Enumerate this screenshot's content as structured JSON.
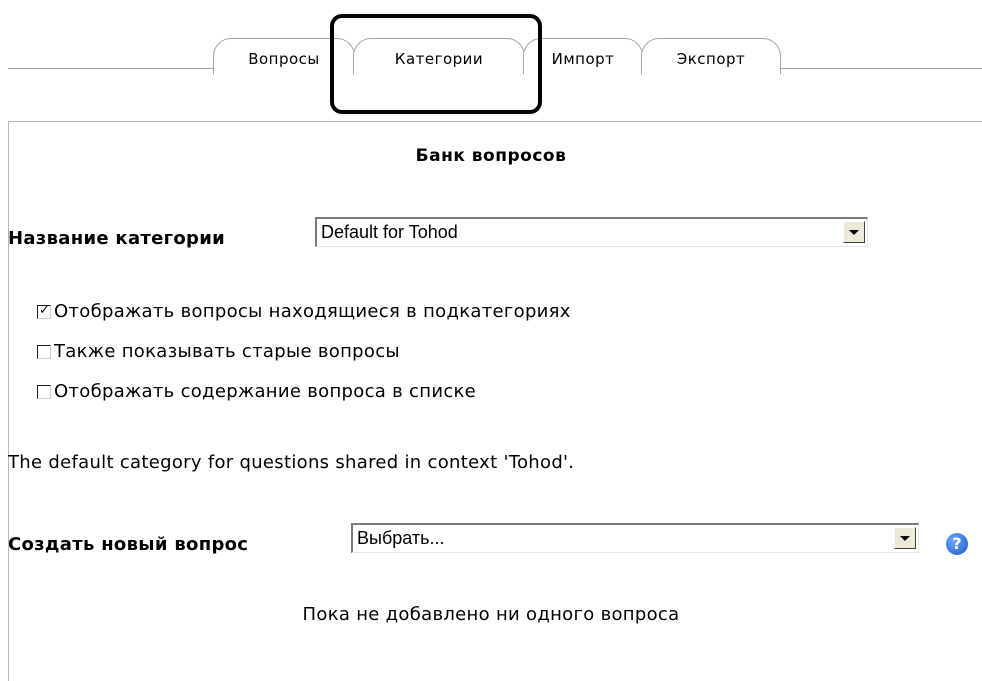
{
  "tabs": [
    {
      "label": "Вопросы"
    },
    {
      "label": "Категории"
    },
    {
      "label": "Импорт"
    },
    {
      "label": "Экспорт"
    }
  ],
  "page_title": "Банк вопросов",
  "category": {
    "label": "Название категории",
    "selected_value": "Default for Tohod"
  },
  "options": [
    {
      "label": "Отображать вопросы находящиеся в подкатегориях",
      "checked": true
    },
    {
      "label": "Также показывать старые вопросы",
      "checked": false
    },
    {
      "label": "Отображать содержание вопроса в списке",
      "checked": false
    }
  ],
  "info_text": "The default category for questions shared in context 'Tohod'.",
  "create_question": {
    "label": "Создать новый вопрос",
    "selected_value": "Выбрать...",
    "help_icon": "help-icon"
  },
  "empty_message": "Пока не добавлено ни одного вопроса",
  "colors": {
    "tab_border": "#a5a5a5",
    "highlight": "#000000",
    "help_icon": "#1a56c8"
  }
}
